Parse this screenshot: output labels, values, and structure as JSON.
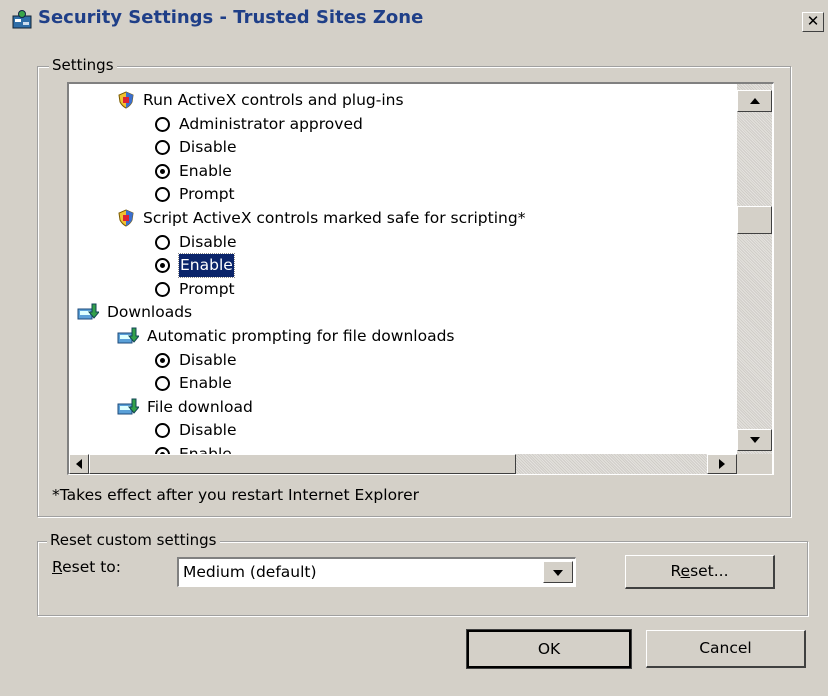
{
  "window": {
    "title": "Security Settings - Trusted Sites Zone",
    "close_glyph": "✕"
  },
  "settings_group": {
    "label": "Settings",
    "rows": [
      {
        "kind": "category",
        "icon": "shield-icon",
        "label": "Run ActiveX controls and plug-ins"
      },
      {
        "kind": "option",
        "label": "Administrator approved",
        "checked": false
      },
      {
        "kind": "option",
        "label": "Disable",
        "checked": false
      },
      {
        "kind": "option",
        "label": "Enable",
        "checked": true
      },
      {
        "kind": "option",
        "label": "Prompt",
        "checked": false
      },
      {
        "kind": "category",
        "icon": "shield-icon",
        "label": "Script ActiveX controls marked safe for scripting*"
      },
      {
        "kind": "option",
        "label": "Disable",
        "checked": false
      },
      {
        "kind": "option",
        "label": "Enable",
        "checked": true,
        "selected": true
      },
      {
        "kind": "option",
        "label": "Prompt",
        "checked": false
      },
      {
        "kind": "section",
        "icon": "download-icon",
        "label": "Downloads"
      },
      {
        "kind": "category",
        "icon": "download-icon",
        "label": "Automatic prompting for file downloads"
      },
      {
        "kind": "option",
        "label": "Disable",
        "checked": true
      },
      {
        "kind": "option",
        "label": "Enable",
        "checked": false
      },
      {
        "kind": "category",
        "icon": "download-icon",
        "label": "File download"
      },
      {
        "kind": "option",
        "label": "Disable",
        "checked": false
      },
      {
        "kind": "option",
        "label": "Enable",
        "checked": true
      }
    ],
    "note": "*Takes effect after you restart Internet Explorer"
  },
  "reset_group": {
    "label": "Reset custom settings",
    "reset_to_label": "Reset to:",
    "reset_to_mnemonic": "R",
    "reset_to_rest": "eset to:",
    "selected_level": "Medium (default)",
    "reset_button_pre": "R",
    "reset_button_mnemonic": "e",
    "reset_button_rest": "set..."
  },
  "footer": {
    "ok_label": "OK",
    "cancel_label": "Cancel"
  }
}
